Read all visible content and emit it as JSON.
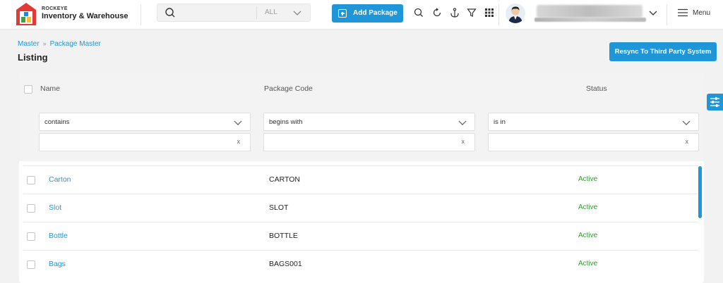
{
  "brand": {
    "small": "ROCKEYE",
    "name": "Inventory & Warehouse"
  },
  "search": {
    "placeholder": "",
    "scope": "ALL"
  },
  "toolbar": {
    "add_label": "Add Package",
    "icons": [
      "search-icon",
      "refresh-icon",
      "anchor-icon",
      "filter-icon",
      "grid-icon"
    ]
  },
  "menu": {
    "label": "Menu"
  },
  "breadcrumb": {
    "items": [
      "Master",
      "Package Master"
    ]
  },
  "page": {
    "title": "Listing"
  },
  "actions": {
    "resync_label": "Resync To Third Party System"
  },
  "table": {
    "columns": [
      "Name",
      "Package Code",
      "Status"
    ],
    "filters": [
      {
        "operator": "contains",
        "value": ""
      },
      {
        "operator": "begins with",
        "value": ""
      },
      {
        "operator": "is in",
        "value": ""
      }
    ],
    "clear_symbol": "x",
    "rows": [
      {
        "name": "Carton",
        "code": "CARTON",
        "status": "Active"
      },
      {
        "name": "Slot",
        "code": "SLOT",
        "status": "Active"
      },
      {
        "name": "Bottle",
        "code": "BOTTLE",
        "status": "Active"
      },
      {
        "name": "Bags",
        "code": "BAGS001",
        "status": "Active"
      }
    ]
  },
  "colors": {
    "accent": "#1e96d8",
    "status_active": "#2e9b2e",
    "background": "#f2f2f2"
  }
}
